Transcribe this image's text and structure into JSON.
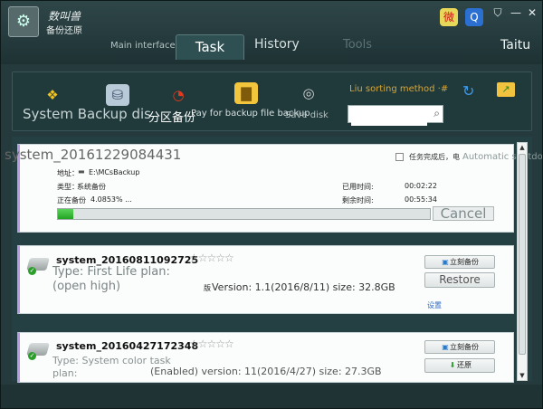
{
  "app": {
    "title": "数叫兽",
    "subtitle": "备份还原",
    "logo_glyph": "⚙"
  },
  "nav": {
    "main": "Main interface",
    "task": "Task",
    "history": "History",
    "tools": "Tools",
    "user": "Taitu"
  },
  "window": {
    "skin": "⛉",
    "min": "—",
    "close": "✕"
  },
  "social": {
    "weibo": "微",
    "qq": "Q"
  },
  "toolbar": {
    "system_label": "System Backup dis",
    "partition_label": "分区备份",
    "file_label": "Pay for backup file backup",
    "save_label": "Save disk",
    "sort_label": "Liu sorting method ·#",
    "search_placeholder": "",
    "icons": {
      "system": "❖",
      "disk": "⛁",
      "partition": "◔",
      "file": "▇",
      "save": "◎",
      "refresh": "↻",
      "open": "↗"
    }
  },
  "tasks": {
    "running": {
      "title": "system_20161229084431",
      "notify_label": "任务完成后，电",
      "auto_shutdown": "Automatic shutdown",
      "address_label": "地址：",
      "address_value": "E:\\MCsBackup",
      "type_label": "类型：",
      "type_value": "系统备份",
      "used_label": "已用时间:",
      "used_value": "00:02:22",
      "progress_label": "正在备份",
      "progress_value": "4.0853% ...",
      "remaining_label": "剩余时间:",
      "remaining_value": "00:55:34",
      "progress_fraction": 0.040853,
      "cancel": "Cancel"
    },
    "items": [
      {
        "name": "system_20160811092725",
        "stars": "☆☆☆☆☆",
        "type_line": "Type: First Life plan:",
        "plan_line": "(open high)",
        "version_mark": "版",
        "version_line": "Version: 1.1(2016/8/11) size: 32.8GB",
        "backup_now": "立刻备份",
        "restore": "Restore",
        "settings": "设置"
      },
      {
        "name": "system_20160427172348",
        "stars": "☆☆☆☆☆",
        "type_line": "Type: System color task",
        "plan_line": "plan:",
        "version_line": "(Enabled) version: 11(2016/4/27) size: 27.3GB",
        "backup_now": "立刻备份",
        "restore": "还原"
      }
    ]
  }
}
